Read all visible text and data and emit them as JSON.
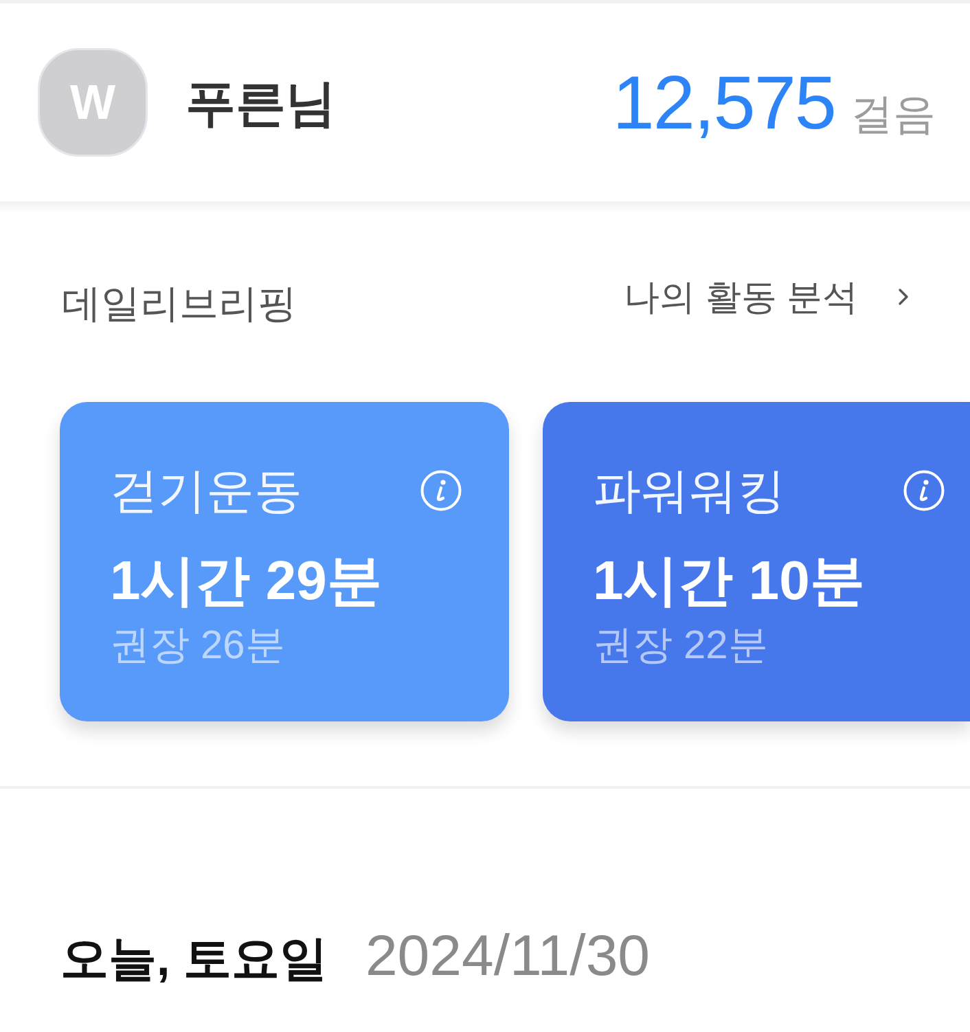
{
  "header": {
    "avatar": {
      "initial": "W"
    },
    "name": "푸른님",
    "steps": {
      "value": "12,575",
      "unit": "걸음"
    }
  },
  "briefing": {
    "title": "데일리브리핑",
    "link": "나의 활동 분석"
  },
  "cards": [
    {
      "title": "걷기운동",
      "duration": "1시간 29분",
      "recommended": "권장 26분",
      "color": "#589af9"
    },
    {
      "title": "파워워킹",
      "duration": "1시간 10분",
      "recommended": "권장 22분",
      "color": "#4677eb"
    }
  ],
  "today": {
    "label": "오늘, 토요일",
    "date": "2024/11/30"
  }
}
